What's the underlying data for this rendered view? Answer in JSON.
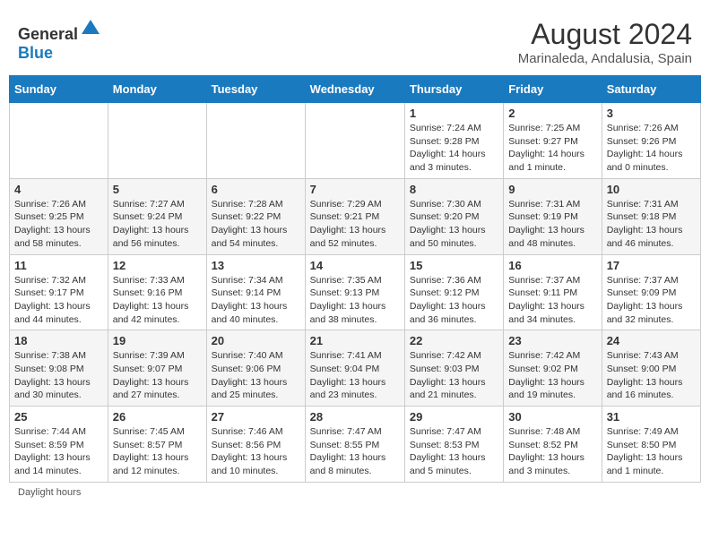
{
  "header": {
    "logo_general": "General",
    "logo_blue": "Blue",
    "month_year": "August 2024",
    "location": "Marinaleda, Andalusia, Spain"
  },
  "days_of_week": [
    "Sunday",
    "Monday",
    "Tuesday",
    "Wednesday",
    "Thursday",
    "Friday",
    "Saturday"
  ],
  "weeks": [
    [
      {
        "day": "",
        "info": ""
      },
      {
        "day": "",
        "info": ""
      },
      {
        "day": "",
        "info": ""
      },
      {
        "day": "",
        "info": ""
      },
      {
        "day": "1",
        "info": "Sunrise: 7:24 AM\nSunset: 9:28 PM\nDaylight: 14 hours\nand 3 minutes."
      },
      {
        "day": "2",
        "info": "Sunrise: 7:25 AM\nSunset: 9:27 PM\nDaylight: 14 hours\nand 1 minute."
      },
      {
        "day": "3",
        "info": "Sunrise: 7:26 AM\nSunset: 9:26 PM\nDaylight: 14 hours\nand 0 minutes."
      }
    ],
    [
      {
        "day": "4",
        "info": "Sunrise: 7:26 AM\nSunset: 9:25 PM\nDaylight: 13 hours\nand 58 minutes."
      },
      {
        "day": "5",
        "info": "Sunrise: 7:27 AM\nSunset: 9:24 PM\nDaylight: 13 hours\nand 56 minutes."
      },
      {
        "day": "6",
        "info": "Sunrise: 7:28 AM\nSunset: 9:22 PM\nDaylight: 13 hours\nand 54 minutes."
      },
      {
        "day": "7",
        "info": "Sunrise: 7:29 AM\nSunset: 9:21 PM\nDaylight: 13 hours\nand 52 minutes."
      },
      {
        "day": "8",
        "info": "Sunrise: 7:30 AM\nSunset: 9:20 PM\nDaylight: 13 hours\nand 50 minutes."
      },
      {
        "day": "9",
        "info": "Sunrise: 7:31 AM\nSunset: 9:19 PM\nDaylight: 13 hours\nand 48 minutes."
      },
      {
        "day": "10",
        "info": "Sunrise: 7:31 AM\nSunset: 9:18 PM\nDaylight: 13 hours\nand 46 minutes."
      }
    ],
    [
      {
        "day": "11",
        "info": "Sunrise: 7:32 AM\nSunset: 9:17 PM\nDaylight: 13 hours\nand 44 minutes."
      },
      {
        "day": "12",
        "info": "Sunrise: 7:33 AM\nSunset: 9:16 PM\nDaylight: 13 hours\nand 42 minutes."
      },
      {
        "day": "13",
        "info": "Sunrise: 7:34 AM\nSunset: 9:14 PM\nDaylight: 13 hours\nand 40 minutes."
      },
      {
        "day": "14",
        "info": "Sunrise: 7:35 AM\nSunset: 9:13 PM\nDaylight: 13 hours\nand 38 minutes."
      },
      {
        "day": "15",
        "info": "Sunrise: 7:36 AM\nSunset: 9:12 PM\nDaylight: 13 hours\nand 36 minutes."
      },
      {
        "day": "16",
        "info": "Sunrise: 7:37 AM\nSunset: 9:11 PM\nDaylight: 13 hours\nand 34 minutes."
      },
      {
        "day": "17",
        "info": "Sunrise: 7:37 AM\nSunset: 9:09 PM\nDaylight: 13 hours\nand 32 minutes."
      }
    ],
    [
      {
        "day": "18",
        "info": "Sunrise: 7:38 AM\nSunset: 9:08 PM\nDaylight: 13 hours\nand 30 minutes."
      },
      {
        "day": "19",
        "info": "Sunrise: 7:39 AM\nSunset: 9:07 PM\nDaylight: 13 hours\nand 27 minutes."
      },
      {
        "day": "20",
        "info": "Sunrise: 7:40 AM\nSunset: 9:06 PM\nDaylight: 13 hours\nand 25 minutes."
      },
      {
        "day": "21",
        "info": "Sunrise: 7:41 AM\nSunset: 9:04 PM\nDaylight: 13 hours\nand 23 minutes."
      },
      {
        "day": "22",
        "info": "Sunrise: 7:42 AM\nSunset: 9:03 PM\nDaylight: 13 hours\nand 21 minutes."
      },
      {
        "day": "23",
        "info": "Sunrise: 7:42 AM\nSunset: 9:02 PM\nDaylight: 13 hours\nand 19 minutes."
      },
      {
        "day": "24",
        "info": "Sunrise: 7:43 AM\nSunset: 9:00 PM\nDaylight: 13 hours\nand 16 minutes."
      }
    ],
    [
      {
        "day": "25",
        "info": "Sunrise: 7:44 AM\nSunset: 8:59 PM\nDaylight: 13 hours\nand 14 minutes."
      },
      {
        "day": "26",
        "info": "Sunrise: 7:45 AM\nSunset: 8:57 PM\nDaylight: 13 hours\nand 12 minutes."
      },
      {
        "day": "27",
        "info": "Sunrise: 7:46 AM\nSunset: 8:56 PM\nDaylight: 13 hours\nand 10 minutes."
      },
      {
        "day": "28",
        "info": "Sunrise: 7:47 AM\nSunset: 8:55 PM\nDaylight: 13 hours\nand 8 minutes."
      },
      {
        "day": "29",
        "info": "Sunrise: 7:47 AM\nSunset: 8:53 PM\nDaylight: 13 hours\nand 5 minutes."
      },
      {
        "day": "30",
        "info": "Sunrise: 7:48 AM\nSunset: 8:52 PM\nDaylight: 13 hours\nand 3 minutes."
      },
      {
        "day": "31",
        "info": "Sunrise: 7:49 AM\nSunset: 8:50 PM\nDaylight: 13 hours\nand 1 minute."
      }
    ]
  ],
  "footer": {
    "daylight_label": "Daylight hours"
  }
}
